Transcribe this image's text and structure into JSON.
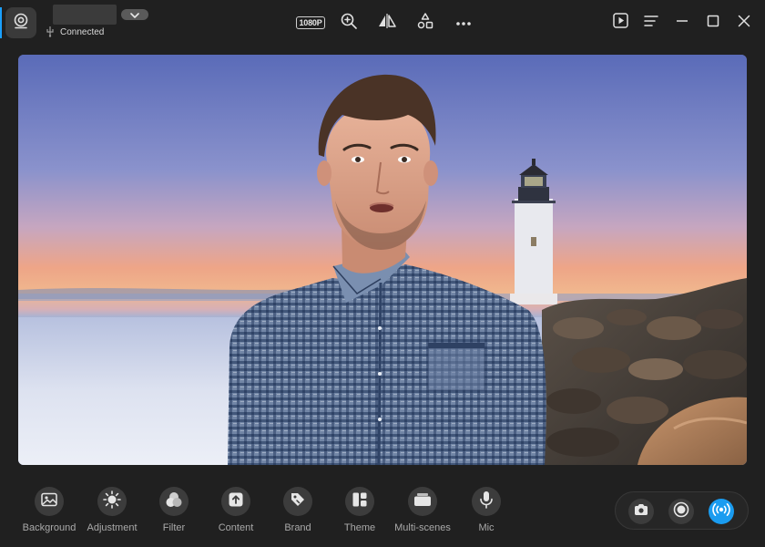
{
  "header": {
    "status_text": "Connected",
    "resolution": "1080P"
  },
  "colors": {
    "background": "#202020",
    "accent": "#1aa0ff",
    "live_button": "#1a9cf0"
  },
  "icons": {
    "camera": "webcam-icon",
    "usb": "usb-icon",
    "zoom": "zoom-in-icon",
    "mirror": "mirror-icon",
    "layout": "shapes-icon",
    "more": "more-icon",
    "play": "play-icon",
    "menu": "menu-icon",
    "minimize": "minimize-icon",
    "maximize": "maximize-icon",
    "close": "close-icon"
  },
  "toolbar": {
    "items": [
      {
        "label": "Background",
        "icon": "image-icon"
      },
      {
        "label": "Adjustment",
        "icon": "brightness-icon"
      },
      {
        "label": "Filter",
        "icon": "filter-icon"
      },
      {
        "label": "Content",
        "icon": "upload-icon"
      },
      {
        "label": "Brand",
        "icon": "tag-icon"
      },
      {
        "label": "Theme",
        "icon": "theme-icon"
      },
      {
        "label": "Multi-scenes",
        "icon": "scenes-icon"
      },
      {
        "label": "Mic",
        "icon": "mic-icon"
      }
    ]
  },
  "capture": {
    "photo_icon": "camera-icon",
    "record_icon": "record-icon",
    "live_icon": "broadcast-icon"
  }
}
